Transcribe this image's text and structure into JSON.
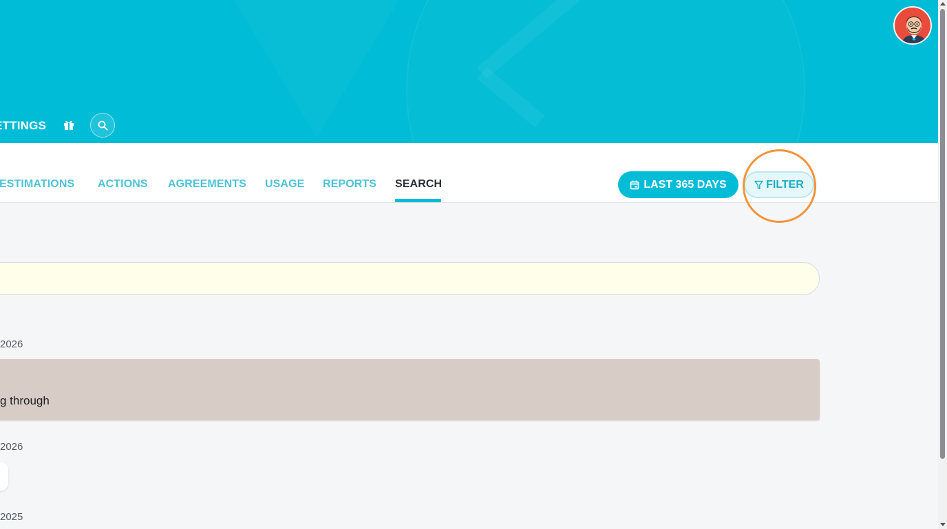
{
  "header": {
    "nav_settings_label": "ETTINGS"
  },
  "tabs": [
    {
      "label": "ESTIMATIONS"
    },
    {
      "label": "ACTIONS"
    },
    {
      "label": "AGREEMENTS"
    },
    {
      "label": "USAGE"
    },
    {
      "label": "REPORTS"
    },
    {
      "label": "SEARCH"
    }
  ],
  "toolbar": {
    "date_range_label": "LAST 365 DAYS",
    "filter_label": "FILTER"
  },
  "results": {
    "date_1": "2026",
    "item_1_text": "g through",
    "date_2": "2026",
    "date_3": "2025"
  },
  "colors": {
    "brand": "#00bcd6",
    "highlight": "#f29339"
  },
  "icons": {
    "gift": "gift-icon",
    "search": "search-icon",
    "calendar": "calendar-icon",
    "filter": "filter-icon"
  }
}
